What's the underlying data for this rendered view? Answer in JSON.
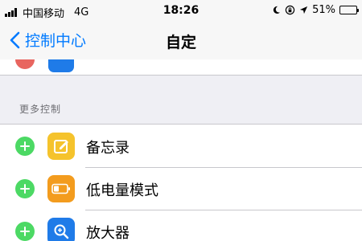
{
  "status_bar": {
    "carrier": "中国移动",
    "network": "4G",
    "time": "18:26",
    "battery": "51%",
    "battery_level": 0.51
  },
  "nav": {
    "back_label": "控制中心",
    "title": "自定"
  },
  "section": {
    "header": "更多控制"
  },
  "items": [
    {
      "label": "备忘录",
      "icon": "notes-icon",
      "icon_color": "#f5c32c"
    },
    {
      "label": "低电量模式",
      "icon": "battery-icon",
      "icon_color": "#f39c1e"
    },
    {
      "label": "放大器",
      "icon": "magnifier-icon",
      "icon_color": "#1f7be8"
    }
  ],
  "colors": {
    "accent": "#007aff",
    "add": "#4cd964",
    "remove": "#e8655f"
  }
}
